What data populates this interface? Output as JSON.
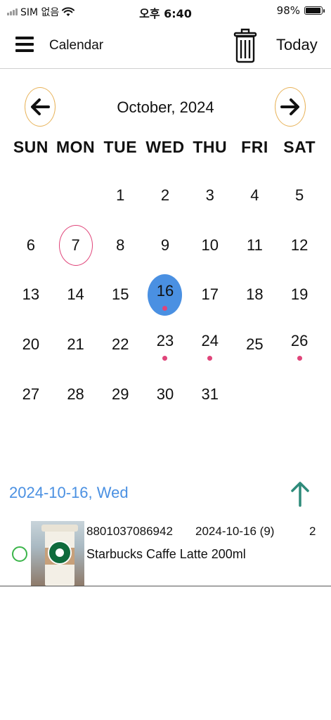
{
  "status_bar": {
    "carrier": "SIM 없음",
    "time": "오후 6:40",
    "battery_text": "98%",
    "battery_level": 0.98
  },
  "header": {
    "title": "Calendar",
    "today_label": "Today"
  },
  "calendar": {
    "month_title": "October, 2024",
    "weekdays": [
      "SUN",
      "MON",
      "TUE",
      "WED",
      "THU",
      "FRI",
      "SAT"
    ],
    "leading_blanks": 2,
    "days": [
      "1",
      "2",
      "3",
      "4",
      "5",
      "6",
      "7",
      "8",
      "9",
      "10",
      "11",
      "12",
      "13",
      "14",
      "15",
      "16",
      "17",
      "18",
      "19",
      "20",
      "21",
      "22",
      "23",
      "24",
      "25",
      "26",
      "27",
      "28",
      "29",
      "30",
      "31"
    ],
    "today": "7",
    "selected": "16",
    "event_days": [
      "16",
      "23",
      "24",
      "26"
    ]
  },
  "selected_date_label": "2024-10-16, Wed",
  "colors": {
    "accent_blue": "#4a90e2",
    "today_ring": "#e0457a",
    "event_dot": "#e0457a",
    "nav_ring": "#e8b35a",
    "status_green": "#3bb54a",
    "arrow_teal": "#2e8b7a"
  },
  "items": [
    {
      "barcode": "8801037086942",
      "date": "2024-10-16 (9)",
      "quantity": "2",
      "name": "Starbucks Caffe Latte 200ml"
    }
  ],
  "icons": {
    "menu": "menu-icon",
    "trash": "trash-icon",
    "prev": "arrow-left-icon",
    "next": "arrow-right-icon",
    "collapse": "arrow-up-icon",
    "wifi": "wifi-icon"
  }
}
